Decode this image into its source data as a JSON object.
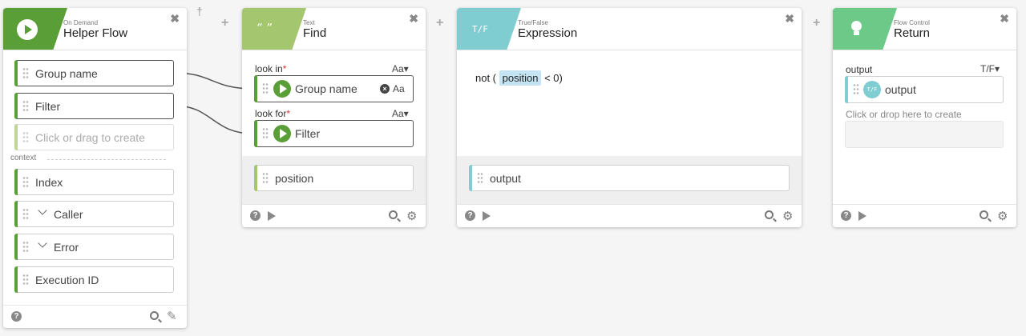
{
  "cards": {
    "helper": {
      "kind": "On Demand",
      "title": "Helper Flow",
      "inputs": [
        "Group name",
        "Filter"
      ],
      "create_placeholder": "Click or drag to create",
      "context_label": "context",
      "context_items": [
        "Index",
        "Caller",
        "Error",
        "Execution ID"
      ]
    },
    "find": {
      "kind": "Text",
      "title": "Find",
      "icon_text": "“ ”",
      "look_in_label": "look in",
      "look_for_label": "look for",
      "required_mark": "*",
      "aa": "Aa▾",
      "aa_plain": "Aa",
      "look_in_value": "Group name",
      "look_for_value": "Filter",
      "output": "position"
    },
    "expression": {
      "kind": "True/False",
      "title": "Expression",
      "icon_text": "T/F",
      "expr_prefix": "not (",
      "expr_token": "position",
      "expr_suffix": "< 0)",
      "output": "output"
    },
    "return": {
      "kind": "Flow Control",
      "title": "Return",
      "output_label": "output",
      "type_selector": "T/F▾",
      "output_value": "output",
      "output_badge": "T/F",
      "drop_hint": "Click or drop here to create"
    }
  },
  "icons": {
    "close": "✖",
    "help": "?",
    "gear": "⚙",
    "pencil": "✎",
    "pin": "†",
    "plus": "+"
  },
  "colors": {
    "green": "#5a9e37",
    "light_green": "#a3c66f",
    "teal": "#7fcdd0",
    "flow_green": "#6dc987",
    "token_bg": "#c5e4f3"
  }
}
